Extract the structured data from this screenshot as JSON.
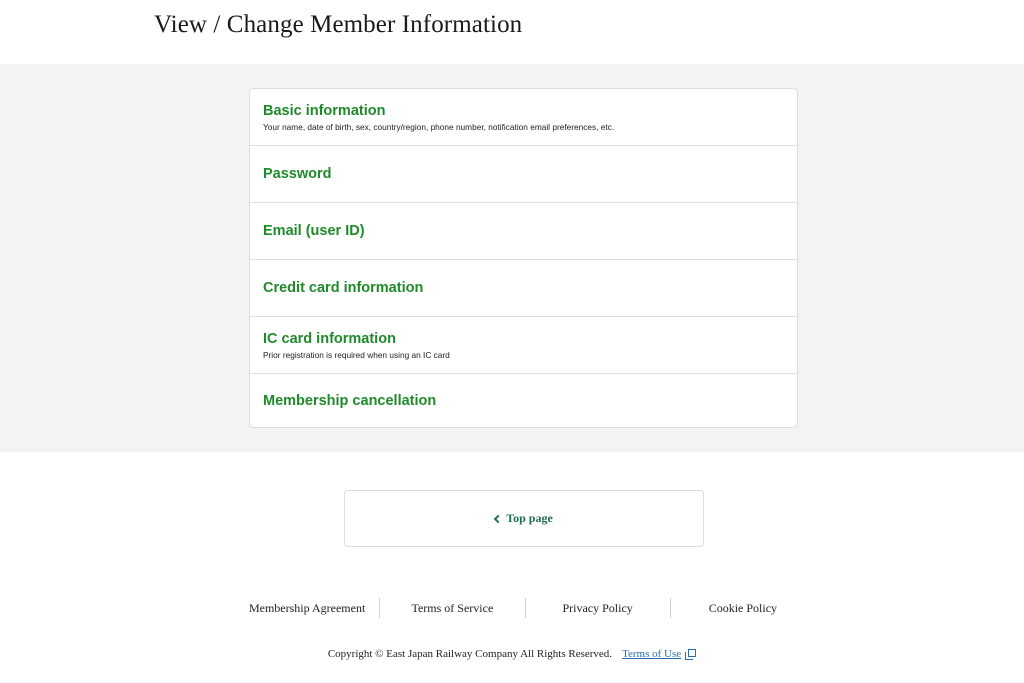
{
  "header": {
    "title": "View / Change Member Information"
  },
  "menu": {
    "items": [
      {
        "id": "basic-information",
        "title": "Basic information",
        "description": "Your name, date of birth, sex, country/region, phone number, notification email preferences, etc."
      },
      {
        "id": "password",
        "title": "Password",
        "description": ""
      },
      {
        "id": "email-user-id",
        "title": "Email (user ID)",
        "description": ""
      },
      {
        "id": "credit-card-information",
        "title": "Credit card information",
        "description": ""
      },
      {
        "id": "ic-card-information",
        "title": "IC card information",
        "description": "Prior registration is required when using an IC card"
      },
      {
        "id": "membership-cancellation",
        "title": "Membership cancellation",
        "description": ""
      }
    ]
  },
  "navigation": {
    "top_page_label": "Top page",
    "top_page_icon": "chevron-left-icon"
  },
  "footer": {
    "links": [
      "Membership Agreement",
      "Terms of Service",
      "Privacy Policy",
      "Cookie Policy"
    ],
    "copyright": "Copyright © East Japan Railway Company All Rights Reserved.",
    "terms_of_use_label": "Terms of Use",
    "terms_of_use_icon": "external-link-icon"
  },
  "colors": {
    "accent_green": "#1f8a2a",
    "button_text_green": "#1f6f4a",
    "link_blue": "#2a6fb5",
    "band_background": "#f3f3f3"
  }
}
